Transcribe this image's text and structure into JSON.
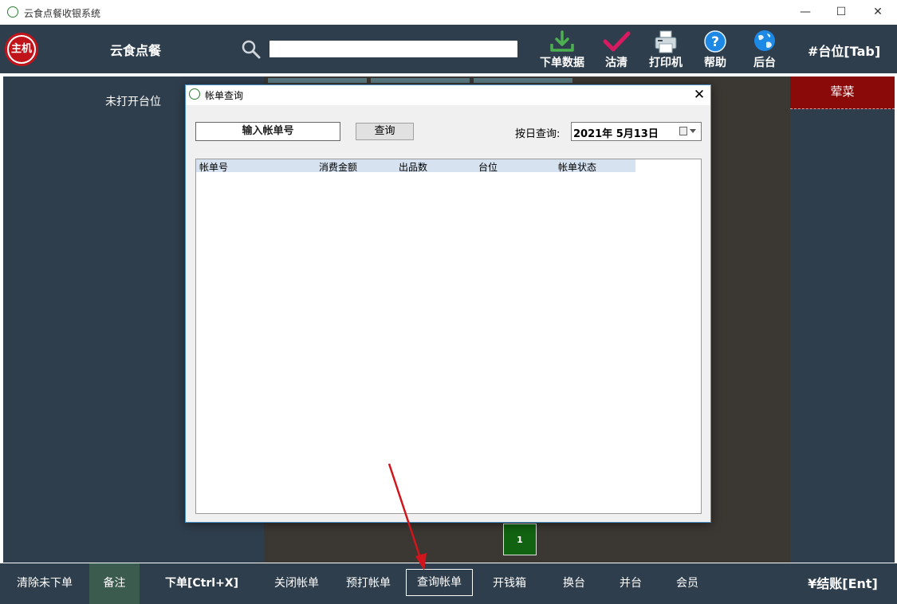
{
  "window": {
    "title": "云食点餐收银系统",
    "minimize": "—",
    "maximize": "☐",
    "close": "✕"
  },
  "header": {
    "host_badge": "主机",
    "brand": "云食点餐",
    "search": {
      "value": "",
      "placeholder": ""
    },
    "tools": [
      {
        "label": "下单数据",
        "icon": "download-icon",
        "color": "#4caf50"
      },
      {
        "label": "沽清",
        "icon": "checkmark-icon",
        "color": "#d81b60"
      },
      {
        "label": "打印机",
        "icon": "printer-icon",
        "color": "#cfd8dc"
      },
      {
        "label": "帮助",
        "icon": "help-icon",
        "color": "#1e88e5"
      },
      {
        "label": "后台",
        "icon": "globe-icon",
        "color": "#1e88e5"
      }
    ],
    "table_tab": "#台位[Tab]"
  },
  "left_panel": {
    "label": "未打开台位"
  },
  "right_panel": {
    "category": "荤菜"
  },
  "pagination": {
    "page": "1"
  },
  "dialog": {
    "title": "帐单查询",
    "close": "✕",
    "bill_input": "输入帐单号",
    "query_button": "查询",
    "date_label": "按日查询:",
    "date_value": "2021年  5月13日",
    "columns": [
      "帐单号",
      "消费金额",
      "出品数",
      "台位",
      "帐单状态"
    ],
    "rows": []
  },
  "bottom_bar": {
    "buttons": [
      "清除未下单",
      "备注",
      "下单[Ctrl+X]",
      "关闭帐单",
      "预打帐单",
      "查询帐单",
      "开钱箱",
      "换台",
      "并台",
      "会员"
    ],
    "checkout": "¥结账[Ent]"
  },
  "colors": {
    "panel": "#2f3e4d",
    "center": "#3b3733",
    "accent_red": "#8a0a0a",
    "page_green": "#116211"
  }
}
